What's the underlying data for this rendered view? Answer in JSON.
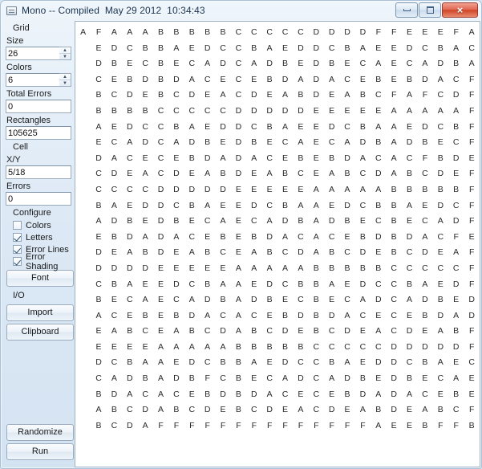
{
  "window": {
    "title": "Mono -- Compiled  May 29 2012  10:34:43",
    "icon": "app-window-icon",
    "buttons": {
      "minimize": "minimize-icon",
      "maximize": "maximize-icon",
      "close": "×"
    }
  },
  "sidebar": {
    "groups": [
      {
        "label": "Grid",
        "fields": [
          {
            "label": "Size",
            "value": "26",
            "spinner": true
          },
          {
            "label": "Colors",
            "value": "6",
            "spinner": true
          },
          {
            "label": "Total Errors",
            "value": "0",
            "spinner": false
          },
          {
            "label": "Rectangles",
            "value": "105625",
            "spinner": false
          }
        ]
      },
      {
        "label": "Cell",
        "fields": [
          {
            "label": "X/Y",
            "value": "5/18",
            "spinner": false
          },
          {
            "label": "Errors",
            "value": "0",
            "spinner": false
          }
        ]
      }
    ],
    "configure": {
      "label": "Configure",
      "checkboxes": [
        {
          "label": "Colors",
          "checked": false
        },
        {
          "label": "Letters",
          "checked": true
        },
        {
          "label": "Error Lines",
          "checked": true
        },
        {
          "label": "Error Shading",
          "checked": true
        }
      ],
      "font_button": "Font"
    },
    "io": {
      "label": "I/O",
      "buttons": [
        "Import",
        "Clipboard"
      ]
    },
    "actions": [
      "Randomize",
      "Run"
    ]
  },
  "grid": {
    "rows": 26,
    "cols": 26,
    "cells": [
      [
        "A",
        "F",
        "A",
        "A",
        "A",
        "B",
        "B",
        "B",
        "B",
        "B",
        "C",
        "C",
        "C",
        "C",
        "C",
        "D",
        "D",
        "D",
        "D",
        "F",
        "F",
        "E",
        "E",
        "E",
        "F",
        "A"
      ],
      [
        "",
        "E",
        "D",
        "C",
        "B",
        "B",
        "A",
        "E",
        "D",
        "C",
        "C",
        "B",
        "A",
        "E",
        "D",
        "D",
        "C",
        "B",
        "A",
        "E",
        "E",
        "D",
        "C",
        "B",
        "A",
        "C"
      ],
      [
        "",
        "D",
        "B",
        "E",
        "C",
        "B",
        "E",
        "C",
        "A",
        "D",
        "C",
        "A",
        "D",
        "B",
        "E",
        "D",
        "B",
        "E",
        "C",
        "A",
        "E",
        "C",
        "A",
        "D",
        "B",
        "A"
      ],
      [
        "",
        "C",
        "E",
        "B",
        "D",
        "B",
        "D",
        "A",
        "C",
        "E",
        "C",
        "E",
        "B",
        "D",
        "A",
        "D",
        "A",
        "C",
        "E",
        "B",
        "E",
        "B",
        "D",
        "A",
        "C",
        "F"
      ],
      [
        "",
        "B",
        "C",
        "D",
        "E",
        "B",
        "C",
        "D",
        "E",
        "A",
        "C",
        "D",
        "E",
        "A",
        "B",
        "D",
        "E",
        "A",
        "B",
        "C",
        "F",
        "A",
        "F",
        "C",
        "D",
        "F"
      ],
      [
        "",
        "B",
        "B",
        "B",
        "B",
        "C",
        "C",
        "C",
        "C",
        "C",
        "D",
        "D",
        "D",
        "D",
        "D",
        "E",
        "E",
        "E",
        "E",
        "E",
        "A",
        "A",
        "A",
        "A",
        "A",
        "F"
      ],
      [
        "",
        "A",
        "E",
        "D",
        "C",
        "C",
        "B",
        "A",
        "E",
        "D",
        "D",
        "C",
        "B",
        "A",
        "E",
        "E",
        "D",
        "C",
        "B",
        "A",
        "A",
        "E",
        "D",
        "C",
        "B",
        "F"
      ],
      [
        "",
        "E",
        "C",
        "A",
        "D",
        "C",
        "A",
        "D",
        "B",
        "E",
        "D",
        "B",
        "E",
        "C",
        "A",
        "E",
        "C",
        "A",
        "D",
        "B",
        "A",
        "D",
        "B",
        "E",
        "C",
        "F"
      ],
      [
        "",
        "D",
        "A",
        "C",
        "E",
        "C",
        "E",
        "B",
        "D",
        "A",
        "D",
        "A",
        "C",
        "E",
        "B",
        "E",
        "B",
        "D",
        "A",
        "C",
        "A",
        "C",
        "F",
        "B",
        "D",
        "E"
      ],
      [
        "",
        "C",
        "D",
        "E",
        "A",
        "C",
        "D",
        "E",
        "A",
        "B",
        "D",
        "E",
        "A",
        "B",
        "C",
        "E",
        "A",
        "B",
        "C",
        "D",
        "A",
        "B",
        "C",
        "D",
        "E",
        "F"
      ],
      [
        "",
        "C",
        "C",
        "C",
        "C",
        "D",
        "D",
        "D",
        "D",
        "D",
        "E",
        "E",
        "E",
        "E",
        "E",
        "A",
        "A",
        "A",
        "A",
        "A",
        "B",
        "B",
        "B",
        "B",
        "B",
        "F"
      ],
      [
        "",
        "B",
        "A",
        "E",
        "D",
        "D",
        "C",
        "B",
        "A",
        "E",
        "E",
        "D",
        "C",
        "B",
        "A",
        "A",
        "E",
        "D",
        "C",
        "B",
        "B",
        "A",
        "E",
        "D",
        "C",
        "F"
      ],
      [
        "",
        "A",
        "D",
        "B",
        "E",
        "D",
        "B",
        "E",
        "C",
        "A",
        "E",
        "C",
        "A",
        "D",
        "B",
        "A",
        "D",
        "B",
        "E",
        "C",
        "B",
        "E",
        "C",
        "A",
        "D",
        "F"
      ],
      [
        "",
        "E",
        "B",
        "D",
        "A",
        "D",
        "A",
        "C",
        "E",
        "B",
        "E",
        "B",
        "D",
        "A",
        "C",
        "A",
        "C",
        "E",
        "B",
        "D",
        "B",
        "D",
        "A",
        "C",
        "F",
        "E"
      ],
      [
        "",
        "D",
        "E",
        "A",
        "B",
        "D",
        "E",
        "A",
        "B",
        "C",
        "E",
        "A",
        "B",
        "C",
        "D",
        "A",
        "B",
        "C",
        "D",
        "E",
        "B",
        "C",
        "D",
        "E",
        "A",
        "F"
      ],
      [
        "",
        "D",
        "D",
        "D",
        "D",
        "E",
        "E",
        "E",
        "E",
        "E",
        "A",
        "A",
        "A",
        "A",
        "A",
        "B",
        "B",
        "B",
        "B",
        "B",
        "C",
        "C",
        "C",
        "C",
        "C",
        "F"
      ],
      [
        "",
        "C",
        "B",
        "A",
        "E",
        "E",
        "D",
        "C",
        "B",
        "A",
        "A",
        "E",
        "D",
        "C",
        "B",
        "B",
        "A",
        "E",
        "D",
        "C",
        "C",
        "B",
        "A",
        "E",
        "D",
        "F"
      ],
      [
        "",
        "B",
        "E",
        "C",
        "A",
        "E",
        "C",
        "A",
        "D",
        "B",
        "A",
        "D",
        "B",
        "E",
        "C",
        "B",
        "E",
        "C",
        "A",
        "D",
        "C",
        "A",
        "D",
        "B",
        "E",
        "D"
      ],
      [
        "",
        "A",
        "C",
        "E",
        "B",
        "E",
        "B",
        "D",
        "A",
        "C",
        "A",
        "C",
        "E",
        "B",
        "D",
        "B",
        "D",
        "A",
        "C",
        "E",
        "C",
        "E",
        "B",
        "D",
        "A",
        "D"
      ],
      [
        "",
        "E",
        "A",
        "B",
        "C",
        "E",
        "A",
        "B",
        "C",
        "D",
        "A",
        "B",
        "C",
        "D",
        "E",
        "B",
        "C",
        "D",
        "E",
        "A",
        "C",
        "D",
        "E",
        "A",
        "B",
        "F"
      ],
      [
        "",
        "E",
        "E",
        "E",
        "E",
        "A",
        "A",
        "A",
        "A",
        "A",
        "B",
        "B",
        "B",
        "B",
        "B",
        "C",
        "C",
        "C",
        "C",
        "C",
        "D",
        "D",
        "D",
        "D",
        "D",
        "F"
      ],
      [
        "",
        "D",
        "C",
        "B",
        "A",
        "A",
        "E",
        "D",
        "C",
        "B",
        "B",
        "A",
        "E",
        "D",
        "C",
        "C",
        "B",
        "A",
        "E",
        "D",
        "D",
        "C",
        "B",
        "A",
        "E",
        "C"
      ],
      [
        "",
        "C",
        "A",
        "D",
        "B",
        "A",
        "D",
        "B",
        "F",
        "C",
        "B",
        "E",
        "C",
        "A",
        "D",
        "C",
        "A",
        "D",
        "B",
        "E",
        "D",
        "B",
        "E",
        "C",
        "A",
        "E"
      ],
      [
        "",
        "B",
        "D",
        "A",
        "C",
        "A",
        "C",
        "E",
        "B",
        "D",
        "B",
        "D",
        "A",
        "C",
        "E",
        "C",
        "E",
        "B",
        "D",
        "A",
        "D",
        "A",
        "C",
        "E",
        "B",
        "E"
      ],
      [
        "",
        "A",
        "B",
        "C",
        "D",
        "A",
        "B",
        "C",
        "D",
        "E",
        "B",
        "C",
        "D",
        "E",
        "A",
        "C",
        "D",
        "E",
        "A",
        "B",
        "D",
        "E",
        "A",
        "B",
        "C",
        "F"
      ],
      [
        "",
        "B",
        "C",
        "D",
        "A",
        "F",
        "F",
        "F",
        "F",
        "F",
        "F",
        "F",
        "F",
        "F",
        "F",
        "F",
        "F",
        "F",
        "F",
        "A",
        "E",
        "E",
        "B",
        "F",
        "F",
        "B"
      ]
    ]
  }
}
